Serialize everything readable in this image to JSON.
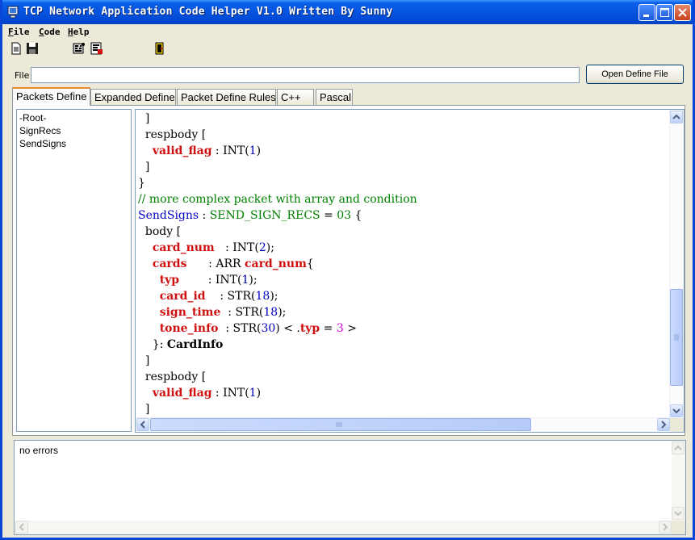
{
  "window": {
    "title": "TCP Network Application Code Helper V1.0 Written By Sunny"
  },
  "menu": [
    {
      "label": "File",
      "mnemonic": "F",
      "rest": "ile"
    },
    {
      "label": "Code",
      "mnemonic": "C",
      "rest": "ode"
    },
    {
      "label": "Help",
      "mnemonic": "H",
      "rest": "elp"
    }
  ],
  "toolbar": {
    "icons": [
      "new-file-icon",
      "save-icon",
      "generate-code-icon",
      "generate-code-2-icon",
      "exit-icon"
    ]
  },
  "file_field": {
    "label": "File",
    "value": "",
    "button_label": "Open Define File"
  },
  "tabs": [
    {
      "label": "Packets Define",
      "active": true
    },
    {
      "label": "Expanded Define",
      "active": false
    },
    {
      "label": "Packet Define Rules",
      "active": false
    },
    {
      "label": "C++",
      "active": false
    },
    {
      "label": "Pascal",
      "active": false
    }
  ],
  "tree": {
    "items": [
      "-Root-",
      "SignRecs",
      "SendSigns"
    ]
  },
  "code_lines": [
    [
      {
        "t": "  ]",
        "c": ""
      }
    ],
    [
      {
        "t": "  respbody [",
        "c": ""
      }
    ],
    [
      {
        "t": "    ",
        "c": ""
      },
      {
        "t": "valid_flag",
        "c": "k-red"
      },
      {
        "t": " : INT(",
        "c": ""
      },
      {
        "t": "1",
        "c": "k-blue"
      },
      {
        "t": ")",
        "c": ""
      }
    ],
    [
      {
        "t": "  ]",
        "c": ""
      }
    ],
    [
      {
        "t": "}",
        "c": ""
      }
    ],
    [
      {
        "t": "// more complex packet with array and condition",
        "c": "k-green"
      }
    ],
    [
      {
        "t": "SendSigns",
        "c": "k-blue"
      },
      {
        "t": " : ",
        "c": ""
      },
      {
        "t": "SEND_SIGN_RECS",
        "c": "k-green"
      },
      {
        "t": " = ",
        "c": ""
      },
      {
        "t": "03",
        "c": "k-green"
      },
      {
        "t": " {",
        "c": ""
      }
    ],
    [
      {
        "t": "  body [",
        "c": ""
      }
    ],
    [
      {
        "t": "    ",
        "c": ""
      },
      {
        "t": "card_num",
        "c": "k-red"
      },
      {
        "t": "   : INT(",
        "c": ""
      },
      {
        "t": "2",
        "c": "k-blue"
      },
      {
        "t": ");",
        "c": ""
      }
    ],
    [
      {
        "t": "    ",
        "c": ""
      },
      {
        "t": "cards",
        "c": "k-red"
      },
      {
        "t": "      : ARR ",
        "c": ""
      },
      {
        "t": "card_num",
        "c": "k-red"
      },
      {
        "t": "{",
        "c": ""
      }
    ],
    [
      {
        "t": "      ",
        "c": ""
      },
      {
        "t": "typ",
        "c": "k-red"
      },
      {
        "t": "        : INT(",
        "c": ""
      },
      {
        "t": "1",
        "c": "k-blue"
      },
      {
        "t": ");",
        "c": ""
      }
    ],
    [
      {
        "t": "      ",
        "c": ""
      },
      {
        "t": "card_id",
        "c": "k-red"
      },
      {
        "t": "    : STR(",
        "c": ""
      },
      {
        "t": "18",
        "c": "k-blue"
      },
      {
        "t": ");",
        "c": ""
      }
    ],
    [
      {
        "t": "      ",
        "c": ""
      },
      {
        "t": "sign_time",
        "c": "k-red"
      },
      {
        "t": "  : STR(",
        "c": ""
      },
      {
        "t": "18",
        "c": "k-blue"
      },
      {
        "t": ");",
        "c": ""
      }
    ],
    [
      {
        "t": "      ",
        "c": ""
      },
      {
        "t": "tone_info",
        "c": "k-red"
      },
      {
        "t": "  : STR(",
        "c": ""
      },
      {
        "t": "30",
        "c": "k-blue"
      },
      {
        "t": ") < .",
        "c": ""
      },
      {
        "t": "typ",
        "c": "k-red"
      },
      {
        "t": " = ",
        "c": ""
      },
      {
        "t": "3",
        "c": "k-mag"
      },
      {
        "t": " >",
        "c": ""
      }
    ],
    [
      {
        "t": "    }: ",
        "c": ""
      },
      {
        "t": "CardInfo",
        "c": "k-black-b"
      }
    ],
    [
      {
        "t": "  ]",
        "c": ""
      }
    ],
    [
      {
        "t": "  respbody [",
        "c": ""
      }
    ],
    [
      {
        "t": "    ",
        "c": ""
      },
      {
        "t": "valid_flag",
        "c": "k-red"
      },
      {
        "t": " : INT(",
        "c": ""
      },
      {
        "t": "1",
        "c": "k-blue"
      },
      {
        "t": ")",
        "c": ""
      }
    ],
    [
      {
        "t": "  ]",
        "c": ""
      }
    ]
  ],
  "output": {
    "text": "no errors"
  },
  "colors": {
    "title_bar": "#0554e0",
    "keyword_red": "#d01010",
    "number_blue": "#0000c0",
    "comment_green": "#008000",
    "magenta": "#d000d0",
    "tab_highlight": "#e68b2c"
  }
}
